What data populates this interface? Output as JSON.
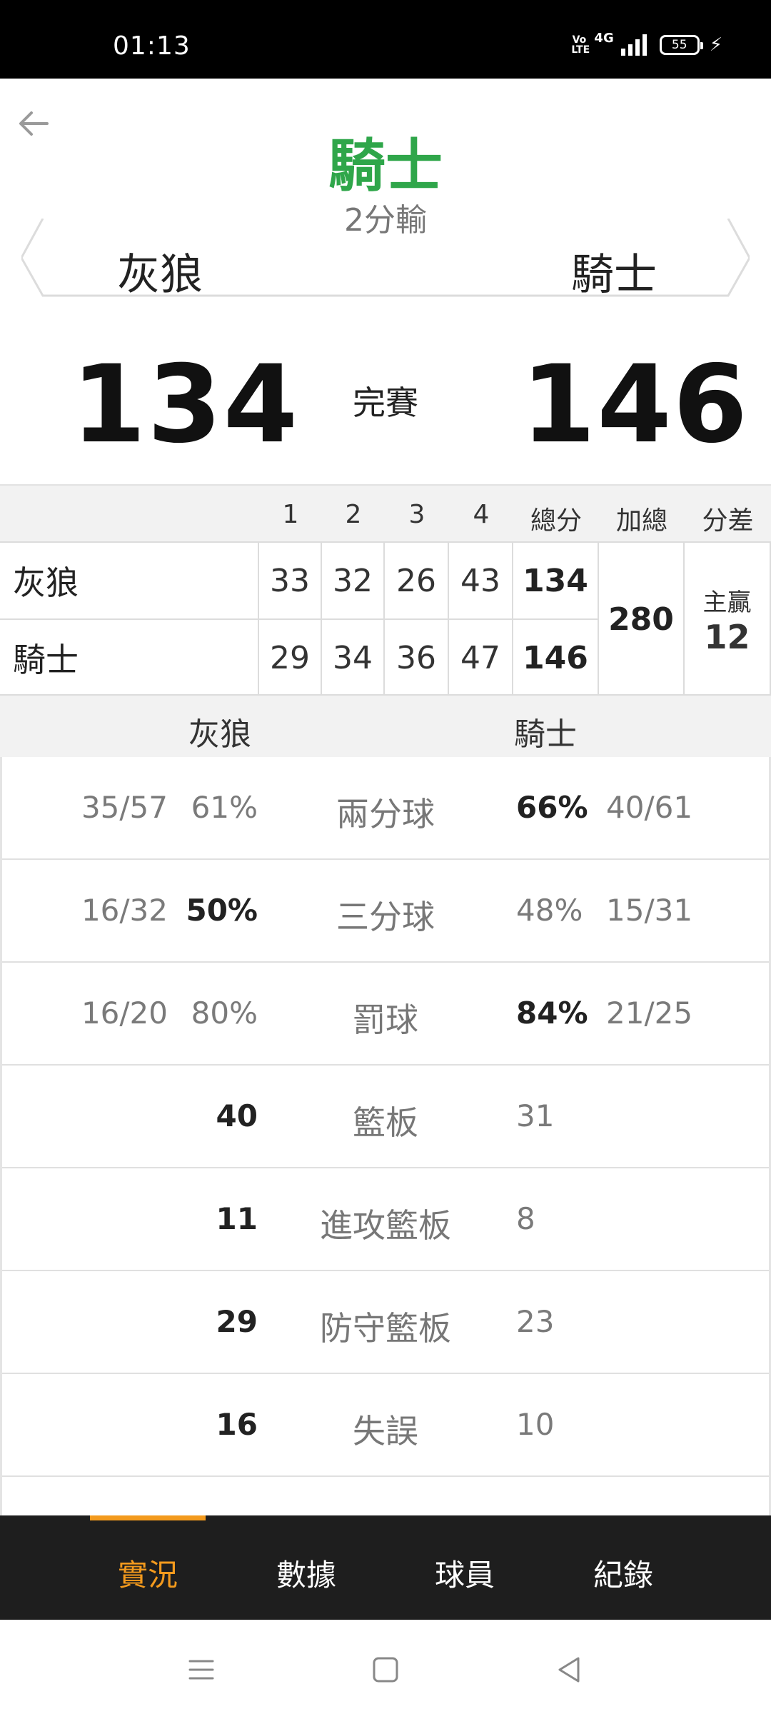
{
  "status_bar": {
    "time": "01:13",
    "volte": "Vo LTE",
    "network": "4G",
    "battery": "55"
  },
  "header": {
    "winner_team": "騎士",
    "result_note": "2分輸",
    "away_team": "灰狼",
    "home_team": "騎士",
    "away_score": "134",
    "home_score": "146",
    "game_status": "完賽"
  },
  "linescore": {
    "columns": [
      "1",
      "2",
      "3",
      "4",
      "總分",
      "加總",
      "分差"
    ],
    "rows": [
      {
        "team": "灰狼",
        "q": [
          "33",
          "32",
          "26",
          "43"
        ],
        "total": "134"
      },
      {
        "team": "騎士",
        "q": [
          "29",
          "34",
          "36",
          "47"
        ],
        "total": "146"
      }
    ],
    "combined": "280",
    "diff_label": "主贏",
    "diff_value": "12"
  },
  "stats": {
    "away_team": "灰狼",
    "home_team": "騎士",
    "rows": [
      {
        "label": "兩分球",
        "away_frac": "35/57",
        "away_val": "61%",
        "home_val": "66%",
        "home_frac": "40/61"
      },
      {
        "label": "三分球",
        "away_frac": "16/32",
        "away_val": "50%",
        "home_val": "48%",
        "home_frac": "15/31"
      },
      {
        "label": "罰球",
        "away_frac": "16/20",
        "away_val": "80%",
        "home_val": "84%",
        "home_frac": "21/25"
      },
      {
        "label": "籃板",
        "away_frac": "",
        "away_val": "40",
        "home_val": "31",
        "home_frac": ""
      },
      {
        "label": "進攻籃板",
        "away_frac": "",
        "away_val": "11",
        "home_val": "8",
        "home_frac": ""
      },
      {
        "label": "防守籃板",
        "away_frac": "",
        "away_val": "29",
        "home_val": "23",
        "home_frac": ""
      },
      {
        "label": "失誤",
        "away_frac": "",
        "away_val": "16",
        "home_val": "10",
        "home_frac": ""
      },
      {
        "label": "",
        "away_frac": "",
        "away_val": "",
        "home_val": "",
        "home_frac": ""
      }
    ]
  },
  "tabs": [
    {
      "label": "實況",
      "active": true
    },
    {
      "label": "數據",
      "active": false
    },
    {
      "label": "球員",
      "active": false
    },
    {
      "label": "紀錄",
      "active": false
    }
  ],
  "colors": {
    "accent": "#f39a1d",
    "winner": "#2fa64a",
    "tabbar": "#1e1e1e"
  },
  "icons": {
    "back": "arrow-left-icon",
    "menu": "menu-icon",
    "home": "home-square-icon",
    "nav_back": "triangle-back-icon"
  }
}
